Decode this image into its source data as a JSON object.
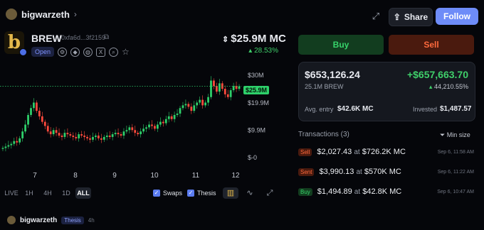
{
  "user": {
    "name": "bigwarzeth"
  },
  "header": {
    "share_label": "Share",
    "follow_label": "Follow"
  },
  "token": {
    "logo_letter": "b",
    "ticker": "BREW",
    "address": "0xfa6d...3f2159",
    "status": "Open",
    "market_cap": "$25.9M MC",
    "change": "28.53%"
  },
  "chart_data": {
    "type": "candlestick",
    "x_ticks": [
      "7",
      "8",
      "9",
      "10",
      "11",
      "12"
    ],
    "y_ticks": [
      "$30M",
      "$19.9M",
      "$9.9M",
      "$-0"
    ],
    "ylim": [
      0,
      32
    ],
    "current_price_label": "$25.9M",
    "current_price": 25.9,
    "series": [
      {
        "name": "price_close",
        "values": [
          3.5,
          4,
          4.5,
          5,
          6,
          5.5,
          7,
          9.5,
          12,
          15.5,
          18,
          20,
          17,
          15,
          13,
          11.5,
          9.5,
          8.5,
          10,
          9,
          8,
          7.5,
          9,
          8.5,
          8,
          7.5,
          7,
          8.5,
          8,
          7.5,
          7,
          6.5,
          7.5,
          8,
          7,
          6.5,
          7.5,
          8,
          7.5,
          8.5,
          9,
          8.5,
          8,
          9.5,
          10,
          11,
          10,
          9,
          8.5,
          9.5,
          10.5,
          11,
          12,
          11.5,
          10.5,
          12,
          13,
          12.5,
          14,
          15,
          14,
          15.5,
          16,
          18,
          19,
          19.5,
          18.5,
          17,
          19,
          20,
          21,
          19,
          20,
          22,
          28,
          26,
          24,
          27,
          25,
          23,
          22,
          24.5,
          26,
          25,
          25.9
        ]
      }
    ]
  },
  "chart_controls": {
    "ranges": [
      "LIVE",
      "1H",
      "4H",
      "1D",
      "ALL"
    ],
    "selected": "ALL",
    "swaps_label": "Swaps",
    "thesis_label": "Thesis",
    "candle_tool": "candles",
    "line_tool": "line"
  },
  "trade": {
    "buy_label": "Buy",
    "sell_label": "Sell"
  },
  "position": {
    "value": "$653,126.24",
    "pnl": "+$657,663.70",
    "amount": "25.1M BREW",
    "pnl_pct": "44,210.55%",
    "entry_label": "Avg. entry",
    "entry_value": "$42.6K MC",
    "invested_label": "Invested",
    "invested_value": "$1,487.57"
  },
  "transactions": {
    "title": "Transactions (3)",
    "filter_label": "Min size",
    "items": [
      {
        "type": "Sell",
        "amount": "$2,027.43",
        "at": "at",
        "mc": "$726.2K MC",
        "time": "Sep 6, 11:58 AM"
      },
      {
        "type": "Sent",
        "amount": "$3,990.13",
        "at": "at",
        "mc": "$570K MC",
        "time": "Sep 6, 11:22 AM"
      },
      {
        "type": "Buy",
        "amount": "$1,494.89",
        "at": "at",
        "mc": "$42.8K MC",
        "time": "Sep 6, 10:47 AM"
      }
    ]
  },
  "post": {
    "author": "bigwarzeth",
    "tag": "Thesis",
    "ago": "4h"
  },
  "colors": {
    "accent": "#6e8cf8",
    "up": "#2ed06a",
    "down": "#ff4a3d",
    "brand": "#e3b84b"
  }
}
